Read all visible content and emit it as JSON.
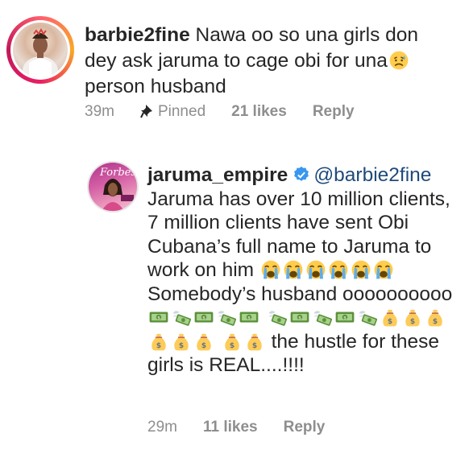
{
  "comment": {
    "username": "barbie2fine",
    "text": "Nawa oo so una girls don dey ask jaruma to cage obi for una",
    "text_after_emoji": "person husband",
    "time": "39m",
    "pinned_label": "Pinned",
    "likes": "21 likes",
    "reply_label": "Reply"
  },
  "reply": {
    "username": "jaruma_empire",
    "mention": "@barbie2fine",
    "text_part1": "Jaruma has over 10 million clients, 7 million clients have sent Obi Cubana’s full name to Jaruma to work on him",
    "text_part2": "Somebody’s  husband oooooooooo",
    "text_part3": "the hustle for these girls is REAL....!!!!",
    "avatar_badge": "Forbes",
    "time": "29m",
    "likes": "11 likes",
    "reply_label": "Reply"
  },
  "colors": {
    "text": "#262626",
    "meta": "#8e8e8e",
    "mention": "#1f4a7a",
    "verified": "#3897f0"
  },
  "icons": {
    "verified": "verified-badge-icon",
    "pin": "pin-icon",
    "crying": "loudly-crying-face-icon",
    "money_wings": "money-with-wings-icon",
    "dollar": "dollar-banknote-icon",
    "money_bag": "money-bag-icon"
  }
}
